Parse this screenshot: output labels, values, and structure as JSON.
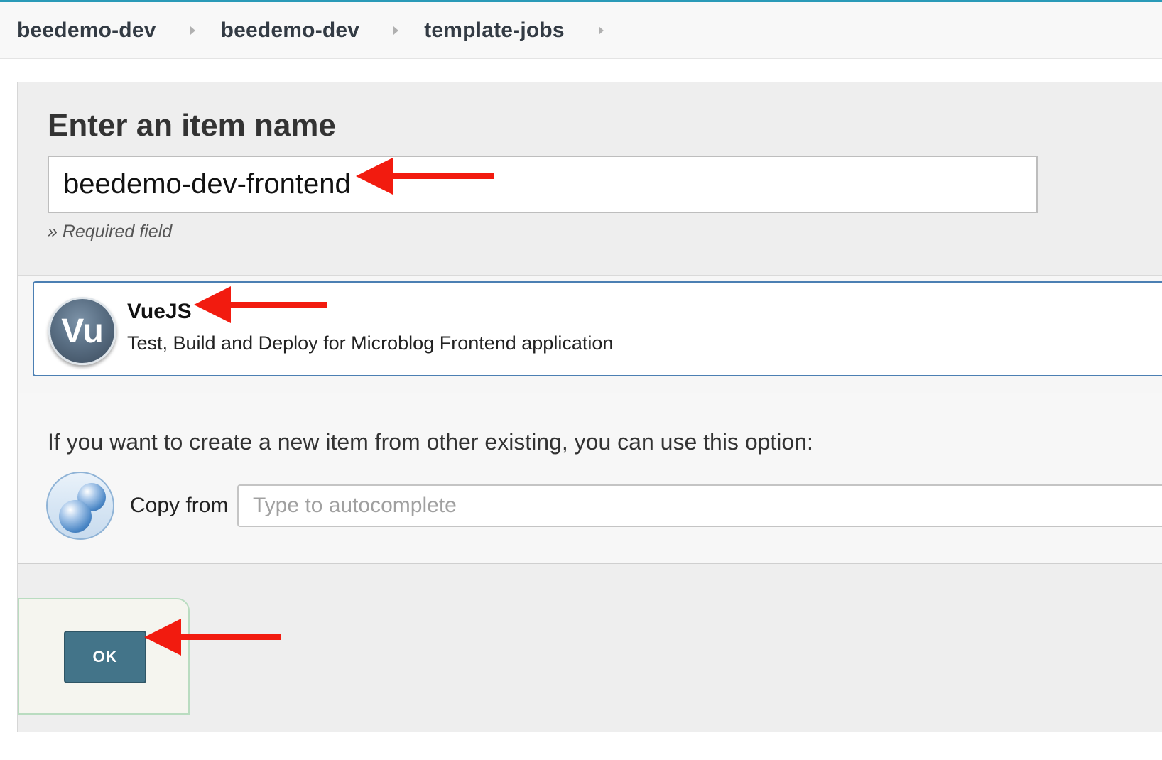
{
  "breadcrumb": {
    "items": [
      {
        "label": "beedemo-dev"
      },
      {
        "label": "beedemo-dev"
      },
      {
        "label": "template-jobs"
      }
    ]
  },
  "form": {
    "title": "Enter an item name",
    "item_name_value": "beedemo-dev-frontend",
    "required_note": "» Required field"
  },
  "template": {
    "icon_text": "Vu",
    "name": "VueJS",
    "description": "Test, Build and Deploy for Microblog Frontend application"
  },
  "copy": {
    "hint": "If you want to create a new item from other existing, you can use this option:",
    "label": "Copy from",
    "placeholder": "Type to autocomplete"
  },
  "footer": {
    "ok_label": "OK"
  },
  "colors": {
    "accent": "#2a9ab8",
    "ok_button": "#437489",
    "annotation_arrow": "#f21b0f",
    "selected_border": "#4b7fb3"
  }
}
